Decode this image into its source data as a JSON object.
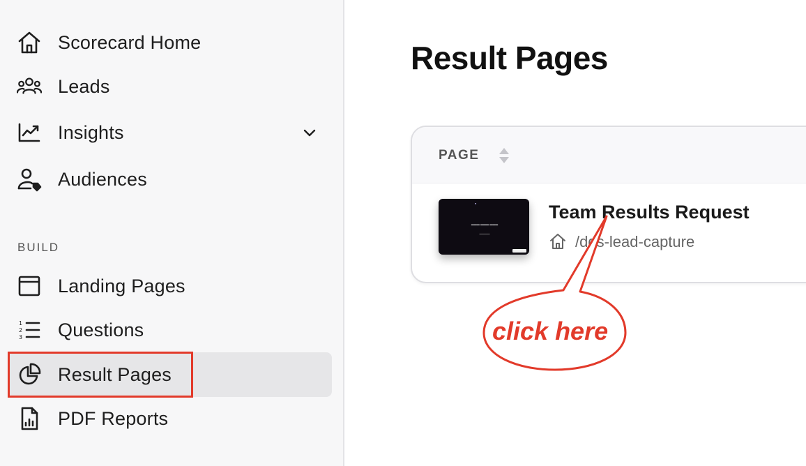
{
  "sidebar": {
    "items": [
      {
        "label": "Scorecard Home",
        "icon": "home-icon"
      },
      {
        "label": "Leads",
        "icon": "users-icon"
      },
      {
        "label": "Insights",
        "icon": "chart-line-icon"
      },
      {
        "label": "Audiences",
        "icon": "user-tag-icon"
      }
    ],
    "build_section_label": "BUILD",
    "build_items": [
      {
        "label": "Landing Pages",
        "icon": "browser-window-icon"
      },
      {
        "label": "Questions",
        "icon": "numbered-list-icon"
      },
      {
        "label": "Result Pages",
        "icon": "pie-chart-icon",
        "active": true
      },
      {
        "label": "PDF Reports",
        "icon": "pdf-report-icon"
      }
    ]
  },
  "main": {
    "title": "Result Pages",
    "table": {
      "column_header": "PAGE",
      "rows": [
        {
          "title": "Team Results Request",
          "path": "/dqs-lead-capture"
        }
      ]
    }
  },
  "annotation": {
    "callout_text": "click here",
    "color": "#e23a2a"
  }
}
